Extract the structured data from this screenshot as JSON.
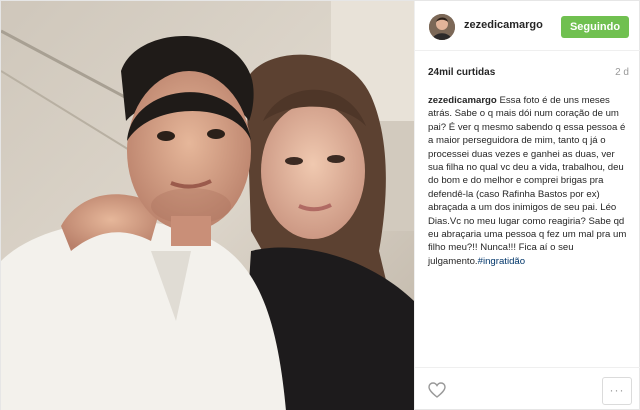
{
  "post": {
    "username": "zezedicamargo",
    "follow_label": "Seguindo",
    "likes": "24mil curtidas",
    "time_ago": "2 d",
    "caption_user": "zezedicamargo",
    "caption_text": " Essa foto é de uns meses atrás. Sabe o q mais dói num coração de um pai? É ver q mesmo sabendo q essa pessoa é a maior perseguidora de mim, tanto q já o processei duas vezes e ganhei as duas, ver sua filha no qual vc deu a vida, trabalhou, deu do bom e do melhor e comprei brigas pra defendê-la (caso Rafinha Bastos por ex) abraçada a um dos inimigos de seu pai. Léo Dias.Vc no meu lugar como reagiria? Sabe qd eu abraçaria uma pessoa q fez um mal pra um filho meu?!! Nunca!!! Fica aí o seu julgamento.",
    "hashtag": "#ingratidão",
    "more_label": "···"
  },
  "icons": {
    "like": "heart-icon",
    "more": "more-options-icon",
    "avatar": "avatar"
  },
  "colors": {
    "follow_button": "#70c050",
    "hashtag": "#003569",
    "meta_text": "#999999"
  }
}
